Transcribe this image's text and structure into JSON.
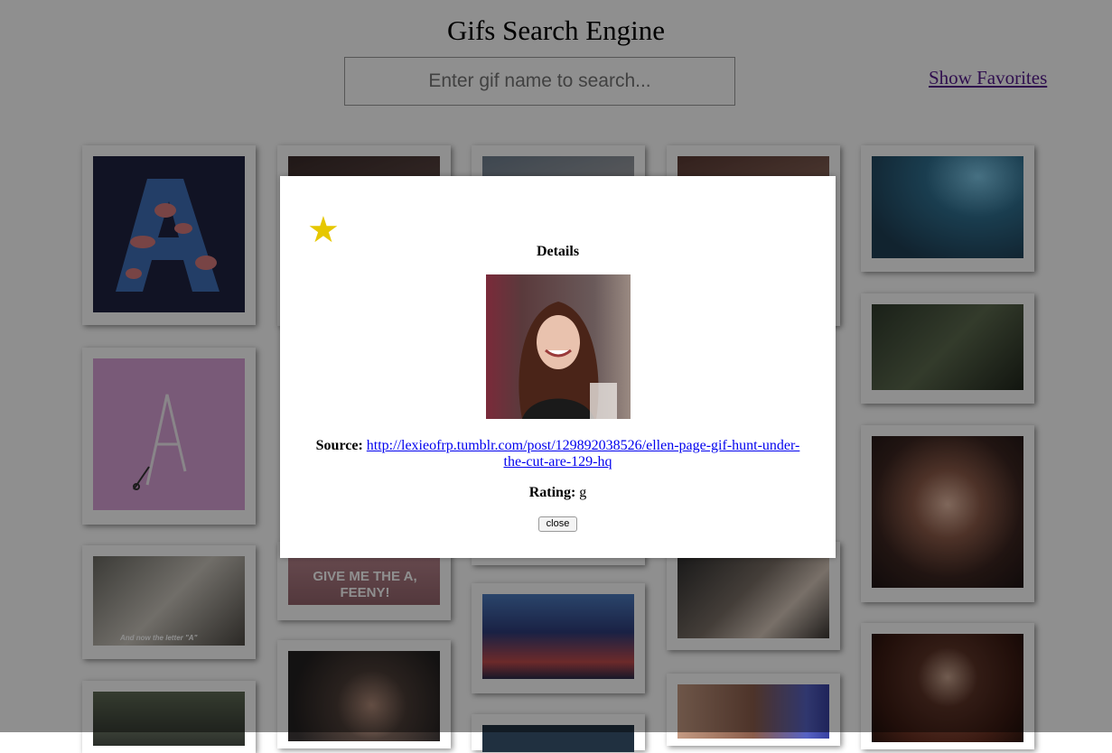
{
  "header": {
    "title": "Gifs Search Engine",
    "search_placeholder": "Enter gif name to search...",
    "favorites_link": "Show Favorites"
  },
  "grid": {
    "caption_feeny": "GIVE ME THE A, FEENY!",
    "caption_letter": "And now the letter \"A\""
  },
  "modal": {
    "favorite_icon": "star-icon",
    "title": "Details",
    "source_label": "Source:",
    "source_url": "http://lexieofrp.tumblr.com/post/129892038526/ellen-page-gif-hunt-under-the-cut-are-129-hq",
    "rating_label": "Rating:",
    "rating_value": "g",
    "close_label": "close"
  },
  "colors": {
    "overlay": "rgba(0,0,0,0.44)",
    "star": "#e6c700",
    "link": "#0000ee",
    "visited_link": "#551a8b"
  }
}
